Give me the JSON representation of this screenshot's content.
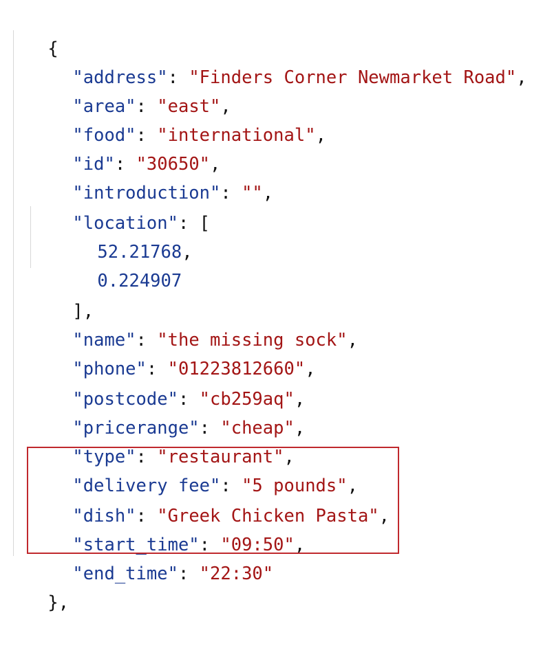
{
  "document": {
    "open_brace": "{",
    "close_brace": "},",
    "fields": [
      {
        "key": "\"address\"",
        "value": "\"Finders Corner Newmarket Road\""
      },
      {
        "key": "\"area\"",
        "value": "\"east\""
      },
      {
        "key": "\"food\"",
        "value": "\"international\""
      },
      {
        "key": "\"id\"",
        "value": "\"30650\""
      },
      {
        "key": "\"introduction\"",
        "value": "\"\""
      },
      {
        "key": "\"location\"",
        "value": "["
      },
      {
        "value": "52.21768"
      },
      {
        "value": "0.224907"
      },
      {
        "value": "]"
      },
      {
        "key": "\"name\"",
        "value": "\"the missing sock\""
      },
      {
        "key": "\"phone\"",
        "value": "\"01223812660\""
      },
      {
        "key": "\"postcode\"",
        "value": "\"cb259aq\""
      },
      {
        "key": "\"pricerange\"",
        "value": "\"cheap\""
      },
      {
        "key": "\"type\"",
        "value": "\"restaurant\""
      },
      {
        "key": "\"delivery fee\"",
        "value": "\"5 pounds\""
      },
      {
        "key": "\"dish\"",
        "value": "\"Greek Chicken Pasta\""
      },
      {
        "key": "\"start_time\"",
        "value": "\"09:50\""
      },
      {
        "key": "\"end_time\"",
        "value": "\"22:30\""
      }
    ]
  },
  "colors": {
    "key": "#1a3a92",
    "string": "#a31515",
    "number": "#1a3a92",
    "highlight_border": "#c0282d"
  }
}
